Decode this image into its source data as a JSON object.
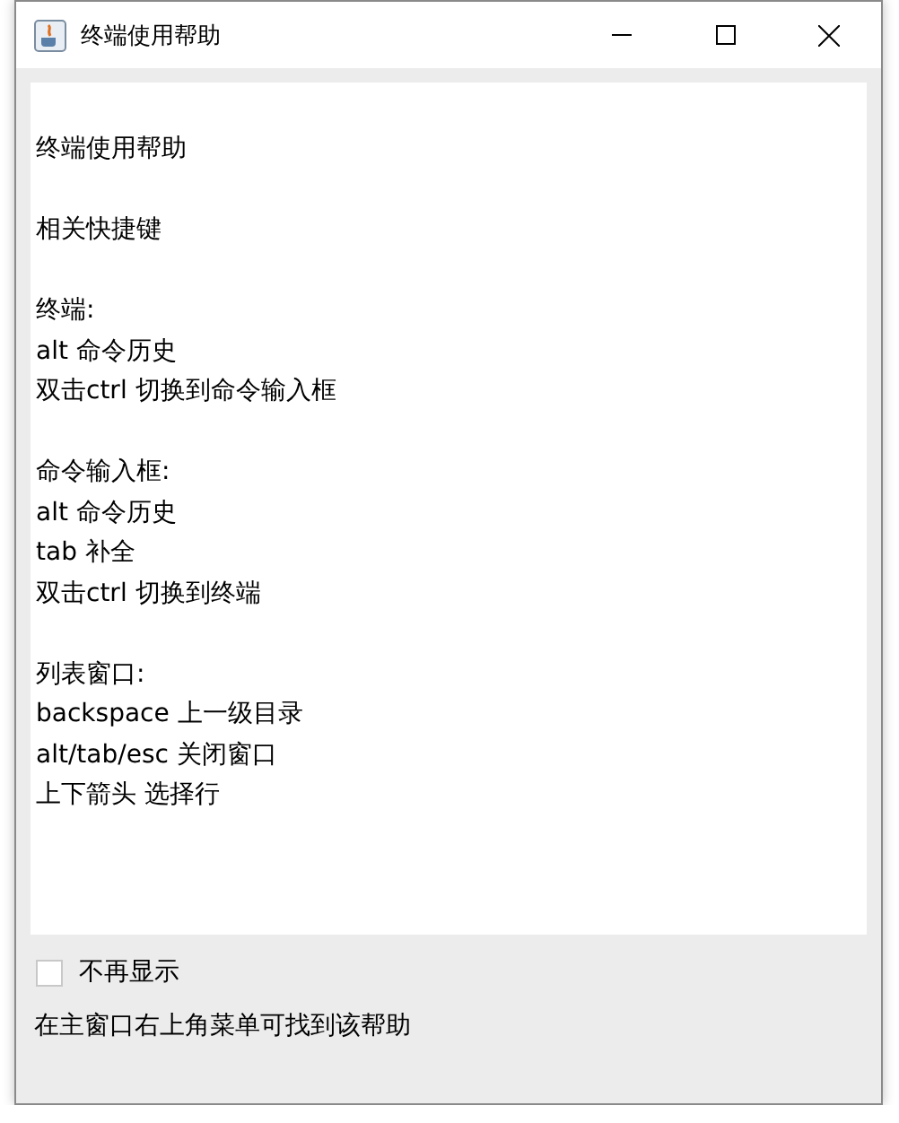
{
  "window": {
    "title": "终端使用帮助"
  },
  "help_text": {
    "blocks": [
      {
        "lines": [
          "终端使用帮助"
        ]
      },
      {
        "lines": [
          "相关快捷键"
        ]
      },
      {
        "lines": [
          "终端:",
          "alt 命令历史",
          "双击ctrl 切换到命令输入框"
        ]
      },
      {
        "lines": [
          "命令输入框:",
          "alt 命令历史",
          "tab 补全",
          "双击ctrl 切换到终端"
        ]
      },
      {
        "lines": [
          "列表窗口:",
          "backspace 上一级目录",
          "alt/tab/esc 关闭窗口",
          "上下箭头 选择行"
        ]
      }
    ]
  },
  "dont_show_again": {
    "label": "不再显示",
    "checked": false
  },
  "footer": "在主窗口右上角菜单可找到该帮助"
}
